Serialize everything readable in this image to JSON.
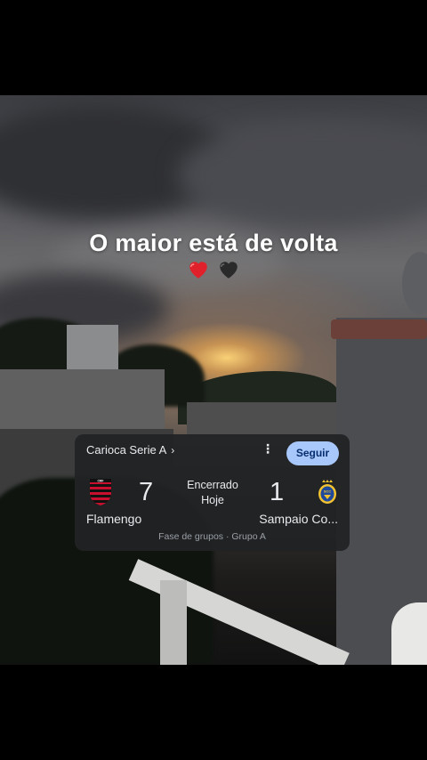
{
  "overlay": {
    "headline": "O maior está de volta",
    "hearts": [
      "red-heart",
      "black-heart"
    ]
  },
  "score_card": {
    "league": "Carioca Serie A",
    "league_chevron": "›",
    "more_icon": "⋮",
    "follow_label": "Seguir",
    "home_team": {
      "name": "Flamengo",
      "score": "7",
      "logo": "flamengo-crest-icon",
      "colors": [
        "#c8102e",
        "#000000"
      ]
    },
    "away_team": {
      "name": "Sampaio Co...",
      "score": "1",
      "logo": "sampaio-crest-icon",
      "colors": [
        "#f2c230",
        "#1f4a9c"
      ]
    },
    "status_line1": "Encerrado",
    "status_line2": "Hoje",
    "phase": "Fase de grupos · Grupo A",
    "accent": "#a8c7fa",
    "background": "#202225"
  }
}
